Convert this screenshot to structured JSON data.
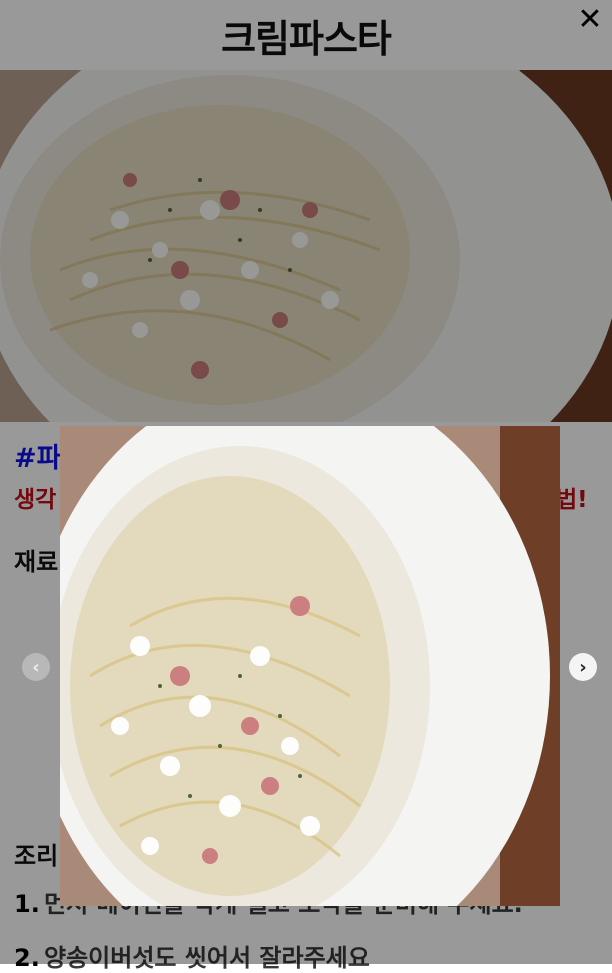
{
  "header": {
    "title": "크림파스타",
    "close_icon": "close-icon"
  },
  "hero": {
    "image_alt": "크림파스타"
  },
  "content": {
    "hashtag": "#파",
    "intro_start": "생각",
    "intro_end": "법!",
    "ingredients_heading": "재료",
    "steps_heading": "조리",
    "steps": [
      {
        "num": "1.",
        "text": "먼저 베이컨을 작게 썰고 조각을 준비해 주세요."
      },
      {
        "num": "2.",
        "text": "양송이버섯도 씻어서 잘라주세요"
      }
    ]
  },
  "lightbox": {
    "image_alt": "크림파스타",
    "prev_icon": "chevron-left-icon",
    "next_icon": "chevron-right-icon"
  },
  "colors": {
    "hashtag": "#1010e8",
    "intro": "#c0101a",
    "overlay": "rgba(0,0,0,0.40)"
  }
}
